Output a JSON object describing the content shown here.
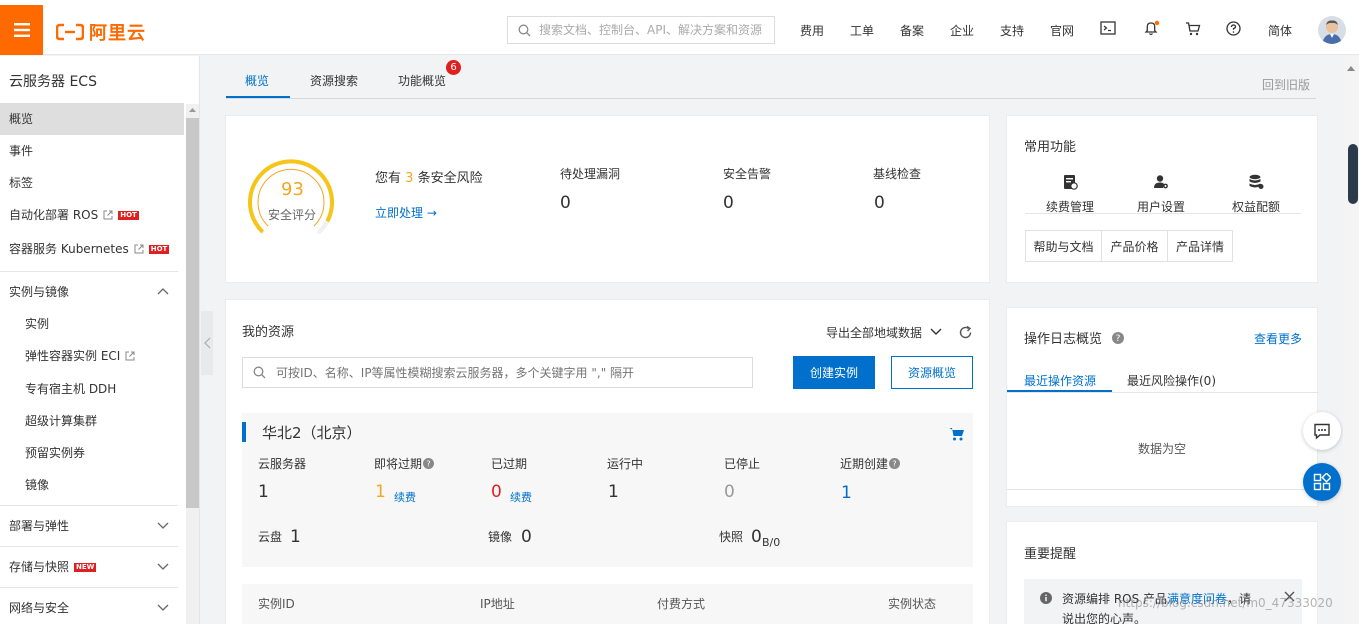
{
  "topbar": {
    "logo_text": "阿里云",
    "search_placeholder": "搜索文档、控制台、API、解决方案和资源",
    "nav": [
      "费用",
      "工单",
      "备案",
      "企业",
      "支持",
      "官网"
    ],
    "lang": "简体"
  },
  "sidebar": {
    "title": "云服务器 ECS",
    "items": [
      {
        "label": "概览"
      },
      {
        "label": "事件"
      },
      {
        "label": "标签"
      },
      {
        "label": "自动化部署 ROS",
        "badge": "HOT"
      },
      {
        "label": "容器服务 Kubernetes",
        "badge": "HOT"
      }
    ],
    "group1": {
      "label": "实例与镜像"
    },
    "sub_items": [
      {
        "label": "实例"
      },
      {
        "label": "弹性容器实例 ECI"
      },
      {
        "label": "专有宿主机 DDH"
      },
      {
        "label": "超级计算集群"
      },
      {
        "label": "预留实例券"
      },
      {
        "label": "镜像"
      }
    ],
    "group2": {
      "label": "部署与弹性"
    },
    "group3": {
      "label": "存储与快照",
      "badge": "NEW"
    },
    "group4": {
      "label": "网络与安全"
    }
  },
  "tabs": {
    "items": [
      "概览",
      "资源搜索",
      "功能概览"
    ],
    "badge_count": "6",
    "back_old": "回到旧版"
  },
  "security": {
    "score": "93",
    "score_label": "安全评分",
    "risk_prefix": "您有",
    "risk_count": "3",
    "risk_suffix": "条安全风险",
    "handle_link": "立即处理 →",
    "stats": [
      {
        "label": "待处理漏洞",
        "value": "0"
      },
      {
        "label": "安全告警",
        "value": "0"
      },
      {
        "label": "基线检查",
        "value": "0"
      }
    ],
    "ring_fraction": 0.93,
    "ring_color": "#f5c518"
  },
  "resources": {
    "title": "我的资源",
    "export_label": "导出全部地域数据",
    "search_placeholder": "可按ID、名称、IP等属性模糊搜索云服务器，多个关键字用 \",\" 隔开",
    "create_btn": "创建实例",
    "overview_btn": "资源概览",
    "region": "华北2（北京）",
    "stats": [
      {
        "label": "云服务器",
        "value": "1"
      },
      {
        "label": "即将过期",
        "value": "1",
        "link": "续费"
      },
      {
        "label": "已过期",
        "value": "0",
        "link": "续费"
      },
      {
        "label": "运行中",
        "value": "1"
      },
      {
        "label": "已停止",
        "value": "0"
      },
      {
        "label": "近期创建",
        "value": "1"
      }
    ],
    "disk_label": "云盘",
    "disk_value": "1",
    "image_label": "镜像",
    "image_value": "0",
    "snapshot_label": "快照",
    "snapshot_value": "0",
    "snapshot_unit": "B/0",
    "table_headers": [
      "实例ID",
      "IP地址",
      "付费方式",
      "实例状态"
    ]
  },
  "common": {
    "title": "常用功能",
    "icons": [
      {
        "label": "续费管理"
      },
      {
        "label": "用户设置"
      },
      {
        "label": "权益配额"
      }
    ],
    "buttons": [
      "帮助与文档",
      "产品价格",
      "产品详情"
    ]
  },
  "oplog": {
    "title": "操作日志概览",
    "more": "查看更多",
    "tabs": [
      "最近操作资源",
      "最近风险操作(0)"
    ],
    "empty": "数据为空"
  },
  "notice": {
    "title": "重要提醒",
    "text_a": "资源编排 ROS 产品",
    "text_link": "满意度问卷",
    "text_b": "，请说出您的心声。"
  },
  "watermark": "https://blog.csdn.net/m0_47333020"
}
